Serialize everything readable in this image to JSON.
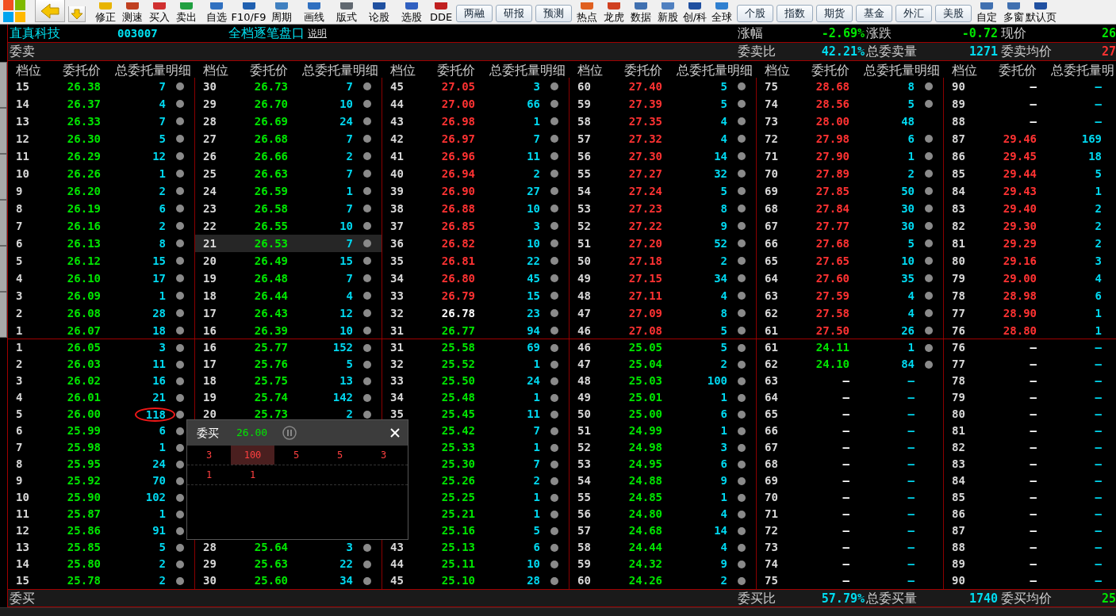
{
  "toolbar": [
    {
      "kind": "tool",
      "label": "修正"
    },
    {
      "kind": "tool",
      "label": "测速"
    },
    {
      "kind": "tool",
      "label": "买入"
    },
    {
      "kind": "tool",
      "label": "卖出"
    },
    {
      "kind": "tool",
      "label": "自选"
    },
    {
      "kind": "tool",
      "label": "F10/F9"
    },
    {
      "kind": "tool",
      "label": "周期"
    },
    {
      "kind": "tool",
      "label": "画线"
    },
    {
      "kind": "tool",
      "label": "版式"
    },
    {
      "kind": "tool",
      "label": "论股"
    },
    {
      "kind": "tool",
      "label": "选股"
    },
    {
      "kind": "tool",
      "label": "DDE"
    },
    {
      "kind": "button",
      "label": "两融"
    },
    {
      "kind": "button",
      "label": "研报"
    },
    {
      "kind": "button",
      "label": "预测"
    },
    {
      "kind": "tool",
      "label": "热点"
    },
    {
      "kind": "tool",
      "label": "龙虎"
    },
    {
      "kind": "tool",
      "label": "数据"
    },
    {
      "kind": "tool",
      "label": "新股"
    },
    {
      "kind": "tool",
      "label": "创/科"
    },
    {
      "kind": "tool",
      "label": "全球"
    },
    {
      "kind": "button",
      "label": "个股"
    },
    {
      "kind": "button",
      "label": "指数"
    },
    {
      "kind": "button",
      "label": "期货"
    },
    {
      "kind": "button",
      "label": "基金"
    },
    {
      "kind": "button",
      "label": "外汇"
    },
    {
      "kind": "button",
      "label": "美股"
    },
    {
      "kind": "tool",
      "label": "自定"
    },
    {
      "kind": "tool",
      "label": "多窗"
    },
    {
      "kind": "tool",
      "label": "默认页"
    }
  ],
  "stock": {
    "name": "直真科技",
    "code": "003007"
  },
  "panel_title": "全档逐笔盘口",
  "help_link": "说明",
  "quote": [
    {
      "label": "涨幅",
      "value": "-2.69%",
      "color": "#00e600"
    },
    {
      "label": "涨跌",
      "value": "-0.72",
      "color": "#00e600"
    },
    {
      "label": "现价",
      "value": "26",
      "color": "#00e600"
    }
  ],
  "sell_label": "委卖",
  "sell_stats": [
    {
      "label": "委卖比",
      "value": "42.21%",
      "color": "#00dcf0"
    },
    {
      "label": "总委卖量",
      "value": "1271",
      "color": "#00dcf0"
    },
    {
      "label": "委卖均价",
      "value": "27",
      "color": "#ff3232"
    }
  ],
  "headers": [
    {
      "level": "档位",
      "price": "委托价",
      "qty": "总委托量明细"
    },
    {
      "level": "档位",
      "price": "委托价",
      "qty": "总委托量明细"
    },
    {
      "level": "档位",
      "price": "委托价",
      "qty": "总委托量明细"
    },
    {
      "level": "档位",
      "price": "委托价",
      "qty": "总委托量明细"
    },
    {
      "level": "档位",
      "price": "委托价",
      "qty": "总委托量明细"
    },
    {
      "level": "档位",
      "price": "委托价",
      "qty": "总委托量明"
    }
  ],
  "sell": [
    [
      {
        "level": "15",
        "price": "26.38",
        "color": "#00e600",
        "qty": "7",
        "dot": true,
        "selected": false
      },
      {
        "level": "14",
        "price": "26.37",
        "color": "#00e600",
        "qty": "4",
        "dot": true,
        "selected": false
      },
      {
        "level": "13",
        "price": "26.33",
        "color": "#00e600",
        "qty": "7",
        "dot": true,
        "selected": false
      },
      {
        "level": "12",
        "price": "26.30",
        "color": "#00e600",
        "qty": "5",
        "dot": true,
        "selected": false
      },
      {
        "level": "11",
        "price": "26.29",
        "color": "#00e600",
        "qty": "12",
        "dot": true,
        "selected": false
      },
      {
        "level": "10",
        "price": "26.26",
        "color": "#00e600",
        "qty": "1",
        "dot": true,
        "selected": false
      },
      {
        "level": "9",
        "price": "26.20",
        "color": "#00e600",
        "qty": "2",
        "dot": true,
        "selected": false
      },
      {
        "level": "8",
        "price": "26.19",
        "color": "#00e600",
        "qty": "6",
        "dot": true,
        "selected": false
      },
      {
        "level": "7",
        "price": "26.16",
        "color": "#00e600",
        "qty": "2",
        "dot": true,
        "selected": false
      },
      {
        "level": "6",
        "price": "26.13",
        "color": "#00e600",
        "qty": "8",
        "dot": true,
        "selected": false
      },
      {
        "level": "5",
        "price": "26.12",
        "color": "#00e600",
        "qty": "15",
        "dot": true,
        "selected": false
      },
      {
        "level": "4",
        "price": "26.10",
        "color": "#00e600",
        "qty": "17",
        "dot": true,
        "selected": false
      },
      {
        "level": "3",
        "price": "26.09",
        "color": "#00e600",
        "qty": "1",
        "dot": true,
        "selected": false
      },
      {
        "level": "2",
        "price": "26.08",
        "color": "#00e600",
        "qty": "28",
        "dot": true,
        "selected": false
      },
      {
        "level": "1",
        "price": "26.07",
        "color": "#00e600",
        "qty": "18",
        "dot": true,
        "selected": false
      }
    ],
    [
      {
        "level": "30",
        "price": "26.73",
        "color": "#00e600",
        "qty": "7",
        "dot": true,
        "selected": false
      },
      {
        "level": "29",
        "price": "26.70",
        "color": "#00e600",
        "qty": "10",
        "dot": true,
        "selected": false
      },
      {
        "level": "28",
        "price": "26.69",
        "color": "#00e600",
        "qty": "24",
        "dot": true,
        "selected": false
      },
      {
        "level": "27",
        "price": "26.68",
        "color": "#00e600",
        "qty": "7",
        "dot": true,
        "selected": false
      },
      {
        "level": "26",
        "price": "26.66",
        "color": "#00e600",
        "qty": "2",
        "dot": true,
        "selected": false
      },
      {
        "level": "25",
        "price": "26.63",
        "color": "#00e600",
        "qty": "7",
        "dot": true,
        "selected": false
      },
      {
        "level": "24",
        "price": "26.59",
        "color": "#00e600",
        "qty": "1",
        "dot": true,
        "selected": false
      },
      {
        "level": "23",
        "price": "26.58",
        "color": "#00e600",
        "qty": "7",
        "dot": true,
        "selected": false
      },
      {
        "level": "22",
        "price": "26.55",
        "color": "#00e600",
        "qty": "10",
        "dot": true,
        "selected": false
      },
      {
        "level": "21",
        "price": "26.53",
        "color": "#00e600",
        "qty": "7",
        "dot": true,
        "selected": true
      },
      {
        "level": "20",
        "price": "26.49",
        "color": "#00e600",
        "qty": "15",
        "dot": true,
        "selected": false
      },
      {
        "level": "19",
        "price": "26.48",
        "color": "#00e600",
        "qty": "7",
        "dot": true,
        "selected": false
      },
      {
        "level": "18",
        "price": "26.44",
        "color": "#00e600",
        "qty": "4",
        "dot": true,
        "selected": false
      },
      {
        "level": "17",
        "price": "26.43",
        "color": "#00e600",
        "qty": "12",
        "dot": true,
        "selected": false
      },
      {
        "level": "16",
        "price": "26.39",
        "color": "#00e600",
        "qty": "10",
        "dot": true,
        "selected": false
      }
    ],
    [
      {
        "level": "45",
        "price": "27.05",
        "color": "#ff3232",
        "qty": "3",
        "dot": true,
        "selected": false
      },
      {
        "level": "44",
        "price": "27.00",
        "color": "#ff3232",
        "qty": "66",
        "dot": true,
        "selected": false
      },
      {
        "level": "43",
        "price": "26.98",
        "color": "#ff3232",
        "qty": "1",
        "dot": true,
        "selected": false
      },
      {
        "level": "42",
        "price": "26.97",
        "color": "#ff3232",
        "qty": "7",
        "dot": true,
        "selected": false
      },
      {
        "level": "41",
        "price": "26.96",
        "color": "#ff3232",
        "qty": "11",
        "dot": true,
        "selected": false
      },
      {
        "level": "40",
        "price": "26.94",
        "color": "#ff3232",
        "qty": "2",
        "dot": true,
        "selected": false
      },
      {
        "level": "39",
        "price": "26.90",
        "color": "#ff3232",
        "qty": "27",
        "dot": true,
        "selected": false
      },
      {
        "level": "38",
        "price": "26.88",
        "color": "#ff3232",
        "qty": "10",
        "dot": true,
        "selected": false
      },
      {
        "level": "37",
        "price": "26.85",
        "color": "#ff3232",
        "qty": "3",
        "dot": true,
        "selected": false
      },
      {
        "level": "36",
        "price": "26.82",
        "color": "#ff3232",
        "qty": "10",
        "dot": true,
        "selected": false
      },
      {
        "level": "35",
        "price": "26.81",
        "color": "#ff3232",
        "qty": "22",
        "dot": true,
        "selected": false
      },
      {
        "level": "34",
        "price": "26.80",
        "color": "#ff3232",
        "qty": "45",
        "dot": true,
        "selected": false
      },
      {
        "level": "33",
        "price": "26.79",
        "color": "#ff3232",
        "qty": "15",
        "dot": true,
        "selected": false
      },
      {
        "level": "32",
        "price": "26.78",
        "color": "#ffffff",
        "qty": "23",
        "dot": true,
        "selected": false
      },
      {
        "level": "31",
        "price": "26.77",
        "color": "#00e600",
        "qty": "94",
        "dot": true,
        "selected": false
      }
    ],
    [
      {
        "level": "60",
        "price": "27.40",
        "color": "#ff3232",
        "qty": "5",
        "dot": true,
        "selected": false
      },
      {
        "level": "59",
        "price": "27.39",
        "color": "#ff3232",
        "qty": "5",
        "dot": true,
        "selected": false
      },
      {
        "level": "58",
        "price": "27.35",
        "color": "#ff3232",
        "qty": "4",
        "dot": true,
        "selected": false
      },
      {
        "level": "57",
        "price": "27.32",
        "color": "#ff3232",
        "qty": "4",
        "dot": true,
        "selected": false
      },
      {
        "level": "56",
        "price": "27.30",
        "color": "#ff3232",
        "qty": "14",
        "dot": true,
        "selected": false
      },
      {
        "level": "55",
        "price": "27.27",
        "color": "#ff3232",
        "qty": "32",
        "dot": true,
        "selected": false
      },
      {
        "level": "54",
        "price": "27.24",
        "color": "#ff3232",
        "qty": "5",
        "dot": true,
        "selected": false
      },
      {
        "level": "53",
        "price": "27.23",
        "color": "#ff3232",
        "qty": "8",
        "dot": true,
        "selected": false
      },
      {
        "level": "52",
        "price": "27.22",
        "color": "#ff3232",
        "qty": "9",
        "dot": true,
        "selected": false
      },
      {
        "level": "51",
        "price": "27.20",
        "color": "#ff3232",
        "qty": "52",
        "dot": true,
        "selected": false
      },
      {
        "level": "50",
        "price": "27.18",
        "color": "#ff3232",
        "qty": "2",
        "dot": true,
        "selected": false
      },
      {
        "level": "49",
        "price": "27.15",
        "color": "#ff3232",
        "qty": "34",
        "dot": true,
        "selected": false
      },
      {
        "level": "48",
        "price": "27.11",
        "color": "#ff3232",
        "qty": "4",
        "dot": true,
        "selected": false
      },
      {
        "level": "47",
        "price": "27.09",
        "color": "#ff3232",
        "qty": "8",
        "dot": true,
        "selected": false
      },
      {
        "level": "46",
        "price": "27.08",
        "color": "#ff3232",
        "qty": "5",
        "dot": true,
        "selected": false
      }
    ],
    [
      {
        "level": "75",
        "price": "28.68",
        "color": "#ff3232",
        "qty": "8",
        "dot": true,
        "selected": false
      },
      {
        "level": "74",
        "price": "28.56",
        "color": "#ff3232",
        "qty": "5",
        "dot": true,
        "selected": false
      },
      {
        "level": "73",
        "price": "28.00",
        "color": "#ff3232",
        "qty": "48",
        "dot": false,
        "selected": false
      },
      {
        "level": "72",
        "price": "27.98",
        "color": "#ff3232",
        "qty": "6",
        "dot": true,
        "selected": false
      },
      {
        "level": "71",
        "price": "27.90",
        "color": "#ff3232",
        "qty": "1",
        "dot": true,
        "selected": false
      },
      {
        "level": "70",
        "price": "27.89",
        "color": "#ff3232",
        "qty": "2",
        "dot": true,
        "selected": false
      },
      {
        "level": "69",
        "price": "27.85",
        "color": "#ff3232",
        "qty": "50",
        "dot": true,
        "selected": false
      },
      {
        "level": "68",
        "price": "27.84",
        "color": "#ff3232",
        "qty": "30",
        "dot": true,
        "selected": false
      },
      {
        "level": "67",
        "price": "27.77",
        "color": "#ff3232",
        "qty": "30",
        "dot": true,
        "selected": false
      },
      {
        "level": "66",
        "price": "27.68",
        "color": "#ff3232",
        "qty": "5",
        "dot": true,
        "selected": false
      },
      {
        "level": "65",
        "price": "27.65",
        "color": "#ff3232",
        "qty": "10",
        "dot": true,
        "selected": false
      },
      {
        "level": "64",
        "price": "27.60",
        "color": "#ff3232",
        "qty": "35",
        "dot": true,
        "selected": false
      },
      {
        "level": "63",
        "price": "27.59",
        "color": "#ff3232",
        "qty": "4",
        "dot": true,
        "selected": false
      },
      {
        "level": "62",
        "price": "27.58",
        "color": "#ff3232",
        "qty": "4",
        "dot": true,
        "selected": false
      },
      {
        "level": "61",
        "price": "27.50",
        "color": "#ff3232",
        "qty": "26",
        "dot": true,
        "selected": false
      }
    ],
    [
      {
        "level": "90",
        "price": "–",
        "color": "#ffffff",
        "qty": "–",
        "dot": false,
        "selected": false
      },
      {
        "level": "89",
        "price": "–",
        "color": "#ffffff",
        "qty": "–",
        "dot": false,
        "selected": false
      },
      {
        "level": "88",
        "price": "–",
        "color": "#ffffff",
        "qty": "–",
        "dot": false,
        "selected": false
      },
      {
        "level": "87",
        "price": "29.46",
        "color": "#ff3232",
        "qty": "169",
        "dot": false,
        "selected": false
      },
      {
        "level": "86",
        "price": "29.45",
        "color": "#ff3232",
        "qty": "18",
        "dot": false,
        "selected": false
      },
      {
        "level": "85",
        "price": "29.44",
        "color": "#ff3232",
        "qty": "5",
        "dot": false,
        "selected": false
      },
      {
        "level": "84",
        "price": "29.43",
        "color": "#ff3232",
        "qty": "1",
        "dot": false,
        "selected": false
      },
      {
        "level": "83",
        "price": "29.40",
        "color": "#ff3232",
        "qty": "2",
        "dot": false,
        "selected": false
      },
      {
        "level": "82",
        "price": "29.30",
        "color": "#ff3232",
        "qty": "2",
        "dot": false,
        "selected": false
      },
      {
        "level": "81",
        "price": "29.29",
        "color": "#ff3232",
        "qty": "2",
        "dot": false,
        "selected": false
      },
      {
        "level": "80",
        "price": "29.16",
        "color": "#ff3232",
        "qty": "3",
        "dot": false,
        "selected": false
      },
      {
        "level": "79",
        "price": "29.00",
        "color": "#ff3232",
        "qty": "4",
        "dot": false,
        "selected": false
      },
      {
        "level": "78",
        "price": "28.98",
        "color": "#ff3232",
        "qty": "6",
        "dot": false,
        "selected": false
      },
      {
        "level": "77",
        "price": "28.90",
        "color": "#ff3232",
        "qty": "1",
        "dot": false,
        "selected": false
      },
      {
        "level": "76",
        "price": "28.80",
        "color": "#ff3232",
        "qty": "1",
        "dot": false,
        "selected": false
      }
    ]
  ],
  "buy": [
    [
      {
        "level": "1",
        "price": "26.05",
        "color": "#00e600",
        "qty": "3",
        "dot": true,
        "selected": false,
        "circled": false
      },
      {
        "level": "2",
        "price": "26.03",
        "color": "#00e600",
        "qty": "11",
        "dot": true,
        "selected": false,
        "circled": false
      },
      {
        "level": "3",
        "price": "26.02",
        "color": "#00e600",
        "qty": "16",
        "dot": true,
        "selected": false,
        "circled": false
      },
      {
        "level": "4",
        "price": "26.01",
        "color": "#00e600",
        "qty": "21",
        "dot": true,
        "selected": false,
        "circled": false
      },
      {
        "level": "5",
        "price": "26.00",
        "color": "#00e600",
        "qty": "118",
        "dot": true,
        "selected": false,
        "circled": true
      },
      {
        "level": "6",
        "price": "25.99",
        "color": "#00e600",
        "qty": "6",
        "dot": true,
        "selected": false,
        "circled": false
      },
      {
        "level": "7",
        "price": "25.98",
        "color": "#00e600",
        "qty": "1",
        "dot": true,
        "selected": false,
        "circled": false
      },
      {
        "level": "8",
        "price": "25.95",
        "color": "#00e600",
        "qty": "24",
        "dot": true,
        "selected": false,
        "circled": false
      },
      {
        "level": "9",
        "price": "25.92",
        "color": "#00e600",
        "qty": "70",
        "dot": true,
        "selected": false,
        "circled": false
      },
      {
        "level": "10",
        "price": "25.90",
        "color": "#00e600",
        "qty": "102",
        "dot": true,
        "selected": false,
        "circled": false
      },
      {
        "level": "11",
        "price": "25.87",
        "color": "#00e600",
        "qty": "1",
        "dot": true,
        "selected": false,
        "circled": false
      },
      {
        "level": "12",
        "price": "25.86",
        "color": "#00e600",
        "qty": "91",
        "dot": true,
        "selected": false,
        "circled": false
      },
      {
        "level": "13",
        "price": "25.85",
        "color": "#00e600",
        "qty": "5",
        "dot": true,
        "selected": false,
        "circled": false
      },
      {
        "level": "14",
        "price": "25.80",
        "color": "#00e600",
        "qty": "2",
        "dot": true,
        "selected": false,
        "circled": false
      },
      {
        "level": "15",
        "price": "25.78",
        "color": "#00e600",
        "qty": "2",
        "dot": true,
        "selected": false,
        "circled": false
      }
    ],
    [
      {
        "level": "16",
        "price": "25.77",
        "color": "#00e600",
        "qty": "152",
        "dot": true,
        "selected": false
      },
      {
        "level": "17",
        "price": "25.76",
        "color": "#00e600",
        "qty": "5",
        "dot": true,
        "selected": false
      },
      {
        "level": "18",
        "price": "25.75",
        "color": "#00e600",
        "qty": "13",
        "dot": true,
        "selected": false
      },
      {
        "level": "19",
        "price": "25.74",
        "color": "#00e600",
        "qty": "142",
        "dot": true,
        "selected": false
      },
      {
        "level": "20",
        "price": "25.73",
        "color": "#00e600",
        "qty": "2",
        "dot": true,
        "selected": false
      },
      {
        "level": "28",
        "price": "25.64",
        "color": "#00e600",
        "qty": "3",
        "dot": true,
        "selected": false,
        "after_cover": true
      },
      {
        "level": "29",
        "price": "25.63",
        "color": "#00e600",
        "qty": "22",
        "dot": true,
        "selected": false
      },
      {
        "level": "30",
        "price": "25.60",
        "color": "#00e600",
        "qty": "34",
        "dot": true,
        "selected": false
      }
    ],
    [
      {
        "level": "31",
        "price": "25.58",
        "color": "#00e600",
        "qty": "69",
        "dot": true,
        "selected": false
      },
      {
        "level": "32",
        "price": "25.52",
        "color": "#00e600",
        "qty": "1",
        "dot": true,
        "selected": false
      },
      {
        "level": "33",
        "price": "25.50",
        "color": "#00e600",
        "qty": "24",
        "dot": true,
        "selected": false
      },
      {
        "level": "34",
        "price": "25.48",
        "color": "#00e600",
        "qty": "1",
        "dot": true,
        "selected": false
      },
      {
        "level": "35",
        "price": "25.45",
        "color": "#00e600",
        "qty": "11",
        "dot": true,
        "selected": false
      },
      {
        "price": "25.42",
        "color": "#00e600",
        "qty": "7",
        "dot": true,
        "selected": false
      },
      {
        "price": "25.33",
        "color": "#00e600",
        "qty": "1",
        "dot": true,
        "selected": false
      },
      {
        "price": "25.30",
        "color": "#00e600",
        "qty": "7",
        "dot": true,
        "selected": false
      },
      {
        "price": "25.26",
        "color": "#00e600",
        "qty": "2",
        "dot": true,
        "selected": false
      },
      {
        "price": "25.25",
        "color": "#00e600",
        "qty": "1",
        "dot": true,
        "selected": false
      },
      {
        "price": "25.21",
        "color": "#00e600",
        "qty": "1",
        "dot": true,
        "selected": false
      },
      {
        "price": "25.16",
        "color": "#00e600",
        "qty": "5",
        "dot": true,
        "selected": false
      },
      {
        "level": "43",
        "price": "25.13",
        "color": "#00e600",
        "qty": "6",
        "dot": true,
        "selected": false
      },
      {
        "level": "44",
        "price": "25.11",
        "color": "#00e600",
        "qty": "10",
        "dot": true,
        "selected": false
      },
      {
        "level": "45",
        "price": "25.10",
        "color": "#00e600",
        "qty": "28",
        "dot": true,
        "selected": false
      }
    ],
    [
      {
        "level": "46",
        "price": "25.05",
        "color": "#00e600",
        "qty": "5",
        "dot": true,
        "selected": false
      },
      {
        "level": "47",
        "price": "25.04",
        "color": "#00e600",
        "qty": "2",
        "dot": true,
        "selected": false
      },
      {
        "level": "48",
        "price": "25.03",
        "color": "#00e600",
        "qty": "100",
        "dot": true,
        "selected": false
      },
      {
        "level": "49",
        "price": "25.01",
        "color": "#00e600",
        "qty": "1",
        "dot": true,
        "selected": false
      },
      {
        "level": "50",
        "price": "25.00",
        "color": "#00e600",
        "qty": "6",
        "dot": true,
        "selected": false
      },
      {
        "level": "51",
        "price": "24.99",
        "color": "#00e600",
        "qty": "1",
        "dot": true,
        "selected": false
      },
      {
        "level": "52",
        "price": "24.98",
        "color": "#00e600",
        "qty": "3",
        "dot": true,
        "selected": false
      },
      {
        "level": "53",
        "price": "24.95",
        "color": "#00e600",
        "qty": "6",
        "dot": true,
        "selected": false
      },
      {
        "level": "54",
        "price": "24.88",
        "color": "#00e600",
        "qty": "9",
        "dot": true,
        "selected": false
      },
      {
        "level": "55",
        "price": "24.85",
        "color": "#00e600",
        "qty": "1",
        "dot": true,
        "selected": false
      },
      {
        "level": "56",
        "price": "24.80",
        "color": "#00e600",
        "qty": "4",
        "dot": true,
        "selected": false
      },
      {
        "level": "57",
        "price": "24.68",
        "color": "#00e600",
        "qty": "14",
        "dot": true,
        "selected": false
      },
      {
        "level": "58",
        "price": "24.44",
        "color": "#00e600",
        "qty": "4",
        "dot": true,
        "selected": false
      },
      {
        "level": "59",
        "price": "24.32",
        "color": "#00e600",
        "qty": "9",
        "dot": true,
        "selected": false
      },
      {
        "level": "60",
        "price": "24.26",
        "color": "#00e600",
        "qty": "2",
        "dot": true,
        "selected": false
      }
    ],
    [
      {
        "level": "61",
        "price": "24.11",
        "color": "#00e600",
        "qty": "1",
        "dot": true,
        "selected": false
      },
      {
        "level": "62",
        "price": "24.10",
        "color": "#00e600",
        "qty": "84",
        "dot": true,
        "selected": false
      },
      {
        "level": "63",
        "price": "–",
        "color": "#ffffff",
        "qty": "–",
        "dot": false,
        "selected": false
      },
      {
        "level": "64",
        "price": "–",
        "color": "#ffffff",
        "qty": "–",
        "dot": false,
        "selected": false
      },
      {
        "level": "65",
        "price": "–",
        "color": "#ffffff",
        "qty": "–",
        "dot": false,
        "selected": false
      },
      {
        "level": "66",
        "price": "–",
        "color": "#ffffff",
        "qty": "–",
        "dot": false,
        "selected": false
      },
      {
        "level": "67",
        "price": "–",
        "color": "#ffffff",
        "qty": "–",
        "dot": false,
        "selected": false
      },
      {
        "level": "68",
        "price": "–",
        "color": "#ffffff",
        "qty": "–",
        "dot": false,
        "selected": false
      },
      {
        "level": "69",
        "price": "–",
        "color": "#ffffff",
        "qty": "–",
        "dot": false,
        "selected": false
      },
      {
        "level": "70",
        "price": "–",
        "color": "#ffffff",
        "qty": "–",
        "dot": false,
        "selected": false
      },
      {
        "level": "71",
        "price": "–",
        "color": "#ffffff",
        "qty": "–",
        "dot": false,
        "selected": false
      },
      {
        "level": "72",
        "price": "–",
        "color": "#ffffff",
        "qty": "–",
        "dot": false,
        "selected": false
      },
      {
        "level": "73",
        "price": "–",
        "color": "#ffffff",
        "qty": "–",
        "dot": false,
        "selected": false
      },
      {
        "level": "74",
        "price": "–",
        "color": "#ffffff",
        "qty": "–",
        "dot": false,
        "selected": false
      },
      {
        "level": "75",
        "price": "–",
        "color": "#ffffff",
        "qty": "–",
        "dot": false,
        "selected": false
      }
    ],
    [
      {
        "level": "76",
        "price": "–",
        "color": "#ffffff",
        "qty": "–",
        "dot": false,
        "selected": false
      },
      {
        "level": "77",
        "price": "–",
        "color": "#ffffff",
        "qty": "–",
        "dot": false,
        "selected": false
      },
      {
        "level": "78",
        "price": "–",
        "color": "#ffffff",
        "qty": "–",
        "dot": false,
        "selected": false
      },
      {
        "level": "79",
        "price": "–",
        "color": "#ffffff",
        "qty": "–",
        "dot": false,
        "selected": false
      },
      {
        "level": "80",
        "price": "–",
        "color": "#ffffff",
        "qty": "–",
        "dot": false,
        "selected": false
      },
      {
        "level": "81",
        "price": "–",
        "color": "#ffffff",
        "qty": "–",
        "dot": false,
        "selected": false
      },
      {
        "level": "82",
        "price": "–",
        "color": "#ffffff",
        "qty": "–",
        "dot": false,
        "selected": false
      },
      {
        "level": "83",
        "price": "–",
        "color": "#ffffff",
        "qty": "–",
        "dot": false,
        "selected": false
      },
      {
        "level": "84",
        "price": "–",
        "color": "#ffffff",
        "qty": "–",
        "dot": false,
        "selected": false
      },
      {
        "level": "85",
        "price": "–",
        "color": "#ffffff",
        "qty": "–",
        "dot": false,
        "selected": false
      },
      {
        "level": "86",
        "price": "–",
        "color": "#ffffff",
        "qty": "–",
        "dot": false,
        "selected": false
      },
      {
        "level": "87",
        "price": "–",
        "color": "#ffffff",
        "qty": "–",
        "dot": false,
        "selected": false
      },
      {
        "level": "88",
        "price": "–",
        "color": "#ffffff",
        "qty": "–",
        "dot": false,
        "selected": false
      },
      {
        "level": "89",
        "price": "–",
        "color": "#ffffff",
        "qty": "–",
        "dot": false,
        "selected": false
      },
      {
        "level": "90",
        "price": "–",
        "color": "#ffffff",
        "qty": "–",
        "dot": false,
        "selected": false
      }
    ]
  ],
  "buy_label": "委买",
  "buy_stats": [
    {
      "label": "委买比",
      "value": "57.79%",
      "color": "#00dcf0"
    },
    {
      "label": "总委买量",
      "value": "1740",
      "color": "#00dcf0"
    },
    {
      "label": "委买均价",
      "value": "25",
      "color": "#00e600"
    }
  ],
  "popup": {
    "title": "委买",
    "price": "26.00",
    "color": "#00e600",
    "rows": [
      [
        {
          "text": "3",
          "selected": false
        },
        {
          "text": "100",
          "selected": true
        },
        {
          "text": "5",
          "selected": false
        },
        {
          "text": "5",
          "selected": false
        },
        {
          "text": "3",
          "selected": false
        }
      ],
      [
        {
          "text": "1",
          "selected": false
        },
        {
          "text": "1",
          "selected": false
        }
      ]
    ]
  }
}
